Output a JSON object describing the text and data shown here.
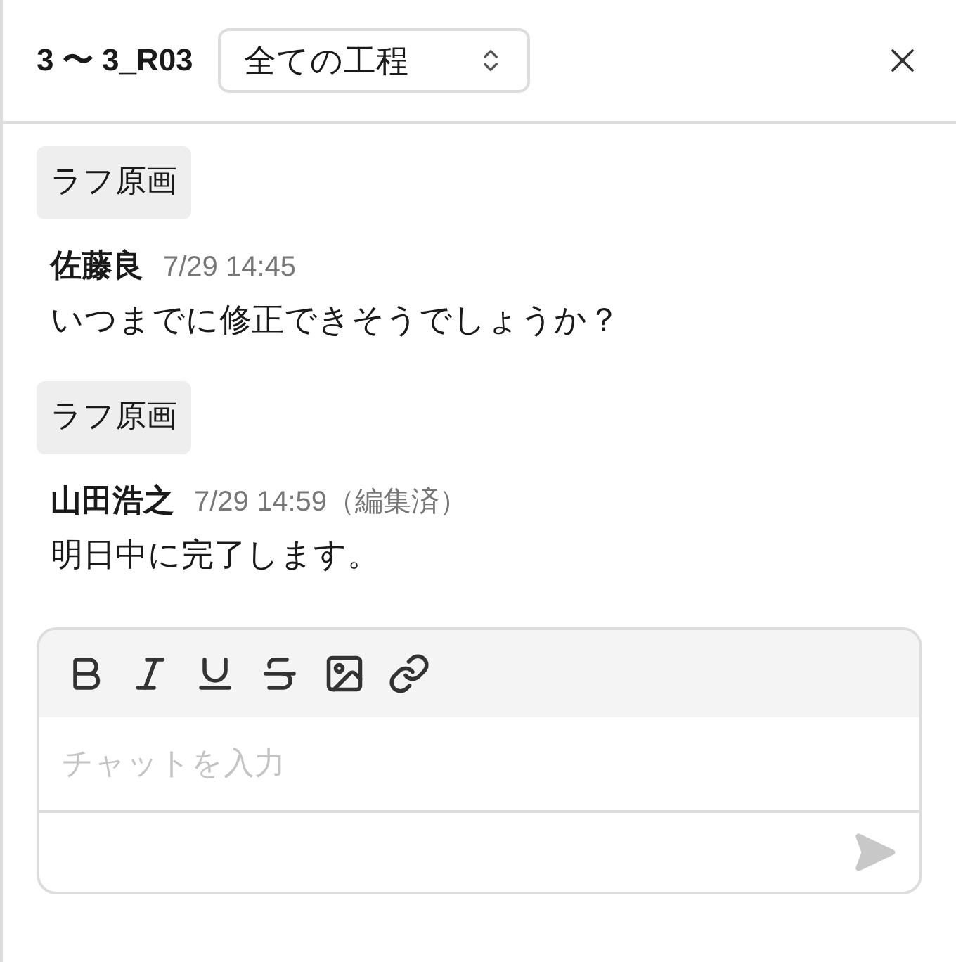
{
  "header": {
    "title": "3 〜 3_R03",
    "filter": {
      "value": "全ての工程"
    }
  },
  "messages": [
    {
      "tag": "ラフ原画",
      "author": "佐藤良",
      "time": "7/29 14:45",
      "text": "いつまでに修正できそうでしょうか？"
    },
    {
      "tag": "ラフ原画",
      "author": "山田浩之",
      "time": "7/29 14:59",
      "edited_note": "（編集済）",
      "text": "明日中に完了します。"
    }
  ],
  "composer": {
    "placeholder": "チャットを入力"
  }
}
